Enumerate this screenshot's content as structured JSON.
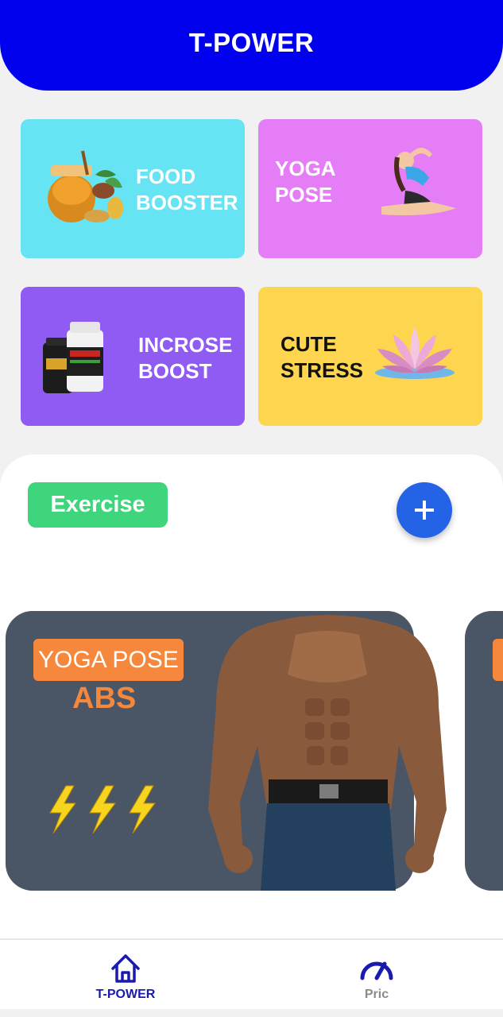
{
  "header": {
    "title": "T-POWER"
  },
  "categories": [
    {
      "label": "FOOD\nBOOSTER",
      "color": "#67e4f4",
      "text_color": "#ffffff",
      "image": "honey-ginger-image"
    },
    {
      "label": "YOGA\nPOSE",
      "color": "#e57df6",
      "text_color": "#ffffff",
      "image": "yoga-pose-image"
    },
    {
      "label": "INCROSE\nBOOST",
      "color": "#8f5bf2",
      "text_color": "#ffffff",
      "image": "supplement-bottles-image"
    },
    {
      "label": "CUTE\nSTRESS",
      "color": "#fdd54e",
      "text_color": "#111111",
      "image": "lotus-flower-image"
    }
  ],
  "section": {
    "chip_label": "Exercise",
    "chip_color": "#3fd57c",
    "fab_icon": "plus-icon",
    "fab_color": "#2563e6"
  },
  "banners": [
    {
      "tag": "YOGA POSE",
      "subtitle": "ABS",
      "accent": "#f5883d",
      "background": "#4a5565",
      "image": "muscular-man-image",
      "icon": "lightning-bolts"
    }
  ],
  "bottom_nav": [
    {
      "label": "T-POWER",
      "icon": "home-icon",
      "active": true,
      "color": "#1a1ab0"
    },
    {
      "label": "Pric",
      "icon": "speedometer-icon",
      "active": false,
      "color": "#8a8a8a"
    }
  ]
}
